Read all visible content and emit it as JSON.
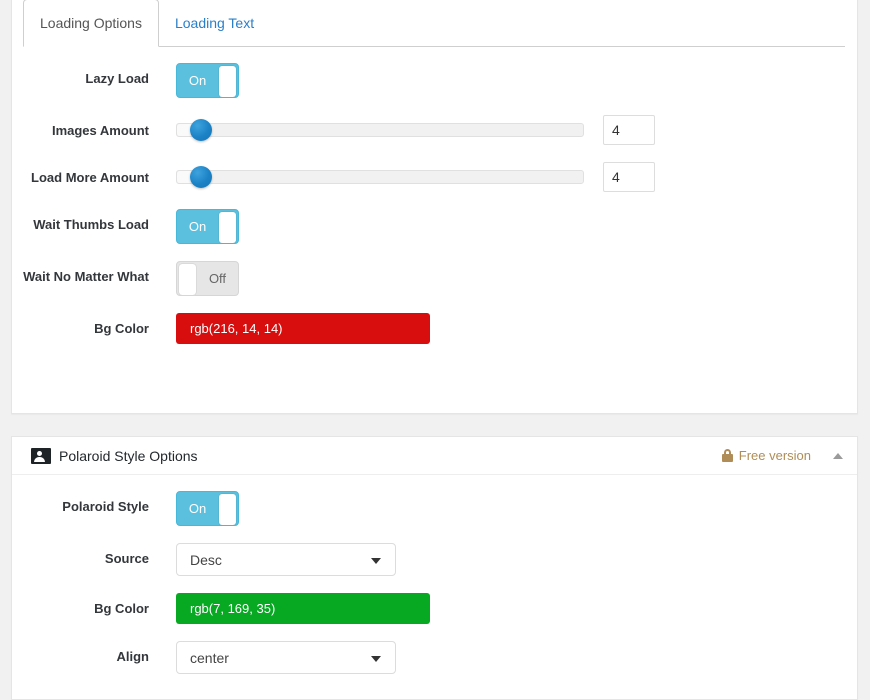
{
  "tabs": [
    {
      "label": "Loading Options",
      "active": true
    },
    {
      "label": "Loading Text",
      "active": false
    }
  ],
  "loading_options": {
    "lazy_load": {
      "label": "Lazy Load",
      "state": "On"
    },
    "images_amount": {
      "label": "Images Amount",
      "value": "4",
      "slider_percent": 6
    },
    "load_more_amount": {
      "label": "Load More Amount",
      "value": "4",
      "slider_percent": 6
    },
    "wait_thumbs_load": {
      "label": "Wait Thumbs Load",
      "state": "On"
    },
    "wait_no_matter_what": {
      "label": "Wait No Matter What",
      "state": "Off"
    },
    "bg_color": {
      "label": "Bg Color",
      "value": "rgb(216, 14, 14)",
      "swatch": "#d80e0e"
    }
  },
  "polaroid_panel": {
    "title": "Polaroid Style Options",
    "icon": "polaroid-card-icon",
    "badge": {
      "text": "Free version",
      "icon": "lock-icon",
      "color": "#b08d57"
    },
    "collapse_icon": "triangle-up-icon",
    "polaroid_style": {
      "label": "Polaroid Style",
      "state": "On"
    },
    "source": {
      "label": "Source",
      "value": "Desc"
    },
    "bg_color": {
      "label": "Bg Color",
      "value": "rgb(7, 169, 35)",
      "swatch": "#07a923"
    },
    "align": {
      "label": "Align",
      "value": "center"
    }
  }
}
